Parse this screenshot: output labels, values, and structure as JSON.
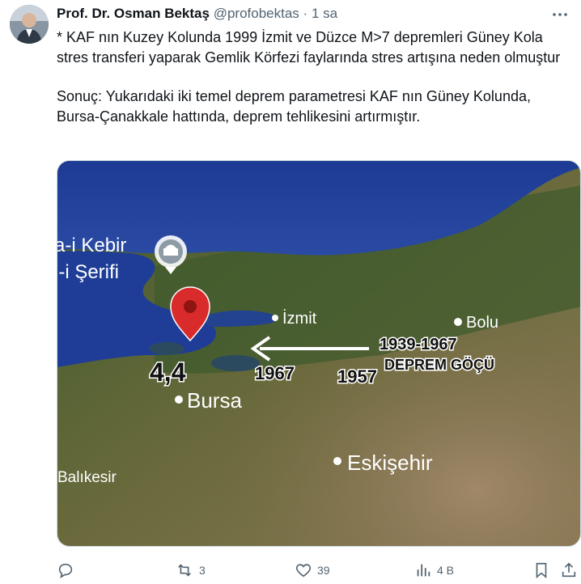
{
  "author": {
    "name": "Prof. Dr. Osman Bektaş",
    "handle": "@profobektas",
    "separator": "·",
    "time": "1 sa"
  },
  "tweet": {
    "paragraph1": "* KAF nın Kuzey Kolunda 1999 İzmit ve Düzce M>7 depremleri Güney Kola stres transferi yaparak Gemlik Körfezi faylarında stres artışına neden olmuştur",
    "paragraph2": "Sonuç: Yukarıdaki iki temel  deprem parametresi KAF nın Güney Kolunda, Bursa-Çanakkale hattında, deprem tehlikesini artırmıştır."
  },
  "map": {
    "place_top_line1": "a-i Kebir",
    "place_top_line2": "i-i Şerifi",
    "izmit": "İzmit",
    "bolu": "Bolu",
    "bursa": "Bursa",
    "eskisehir": "Eskişehir",
    "balikesir": "Balıkesir",
    "magnitude": "4,4",
    "year_1967": "1967",
    "year_1957": "1957",
    "range": "1939-1967",
    "migration": "DEPREM GÖÇÜ"
  },
  "actions": {
    "reply_count": "",
    "retweet_count": "3",
    "like_count": "39",
    "views_count": "4 B"
  }
}
